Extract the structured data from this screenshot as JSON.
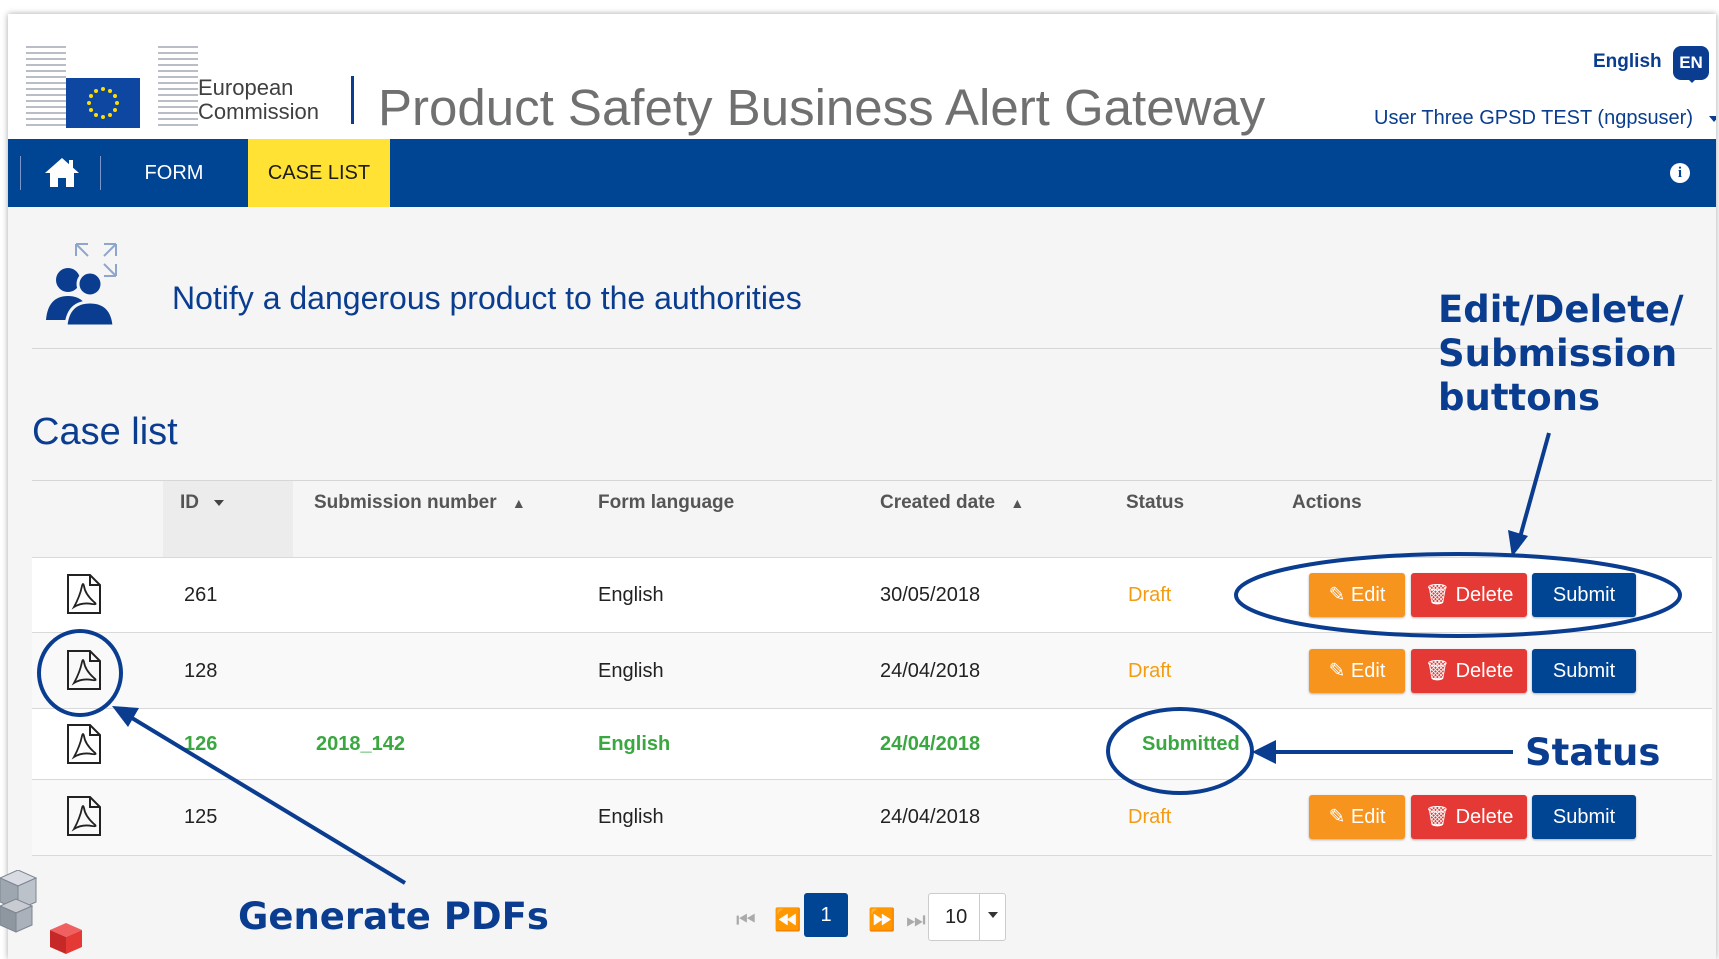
{
  "header": {
    "org_line1": "European",
    "org_line2": "Commission",
    "app_title": "Product Safety Business Alert Gateway",
    "language_label": "English",
    "language_code": "EN",
    "user": "User Three GPSD TEST (ngpsuser)"
  },
  "nav": {
    "home_icon": "home-icon",
    "items": [
      {
        "label": "FORM"
      },
      {
        "label": "CASE LIST",
        "active": true
      }
    ],
    "info_icon": "info-icon"
  },
  "intro": {
    "text": "Notify a dangerous product to the authorities"
  },
  "page_title": "Case list",
  "table": {
    "columns": [
      "ID",
      "Submission number",
      "Form language",
      "Created date",
      "Status",
      "Actions"
    ],
    "rows": [
      {
        "id": "261",
        "submission": "",
        "language": "English",
        "created": "30/05/2018",
        "status": "Draft"
      },
      {
        "id": "128",
        "submission": "",
        "language": "English",
        "created": "24/04/2018",
        "status": "Draft"
      },
      {
        "id": "126",
        "submission": "2018_142",
        "language": "English",
        "created": "24/04/2018",
        "status": "Submitted"
      },
      {
        "id": "125",
        "submission": "",
        "language": "English",
        "created": "24/04/2018",
        "status": "Draft"
      }
    ],
    "actions": {
      "edit": "Edit",
      "delete": "Delete",
      "submit": "Submit"
    }
  },
  "pagination": {
    "current_page": "1",
    "page_size": "10"
  },
  "annotations": {
    "buttons_line1": "Edit/Delete/",
    "buttons_line2": "Submission",
    "buttons_line3": "buttons",
    "status": "Status",
    "pdfs": "Generate PDFs"
  },
  "colors": {
    "brand_blue": "#004494",
    "active_tab": "#ffe234",
    "draft": "#f39c12",
    "submitted": "#3aa741",
    "edit": "#f7941d",
    "delete": "#e53935"
  }
}
